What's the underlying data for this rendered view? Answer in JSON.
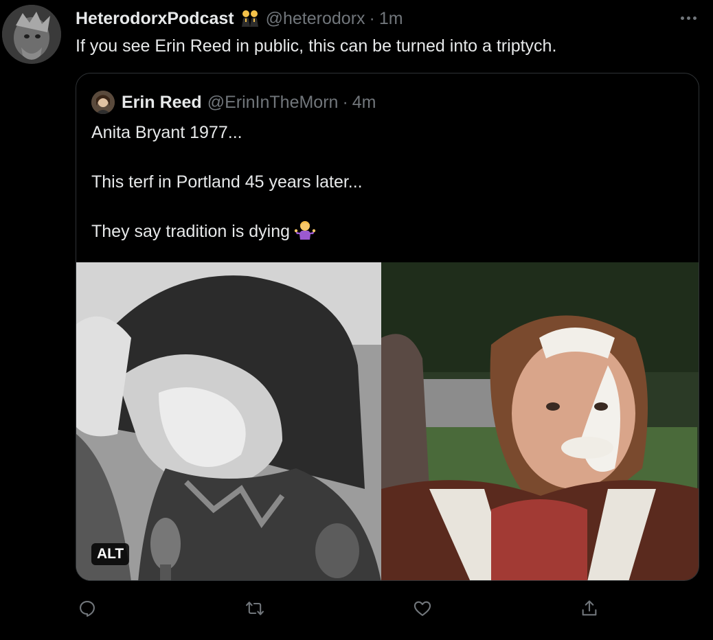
{
  "tweet": {
    "author": {
      "display_name": "HeterodorxPodcast",
      "handle": "@heterodorx",
      "time": "1m",
      "badge_emoji": "two-men-emoji"
    },
    "separator": "·",
    "text": "If you see Erin Reed in public, this can be turned into a triptych."
  },
  "quote": {
    "author": {
      "display_name": "Erin Reed",
      "handle": "@ErinInTheMorn",
      "time": "4m"
    },
    "lines": [
      "Anita Bryant 1977...",
      "This terf in Portland 45 years later...",
      "They say tradition is dying"
    ],
    "trailing_emoji": "person-shrugging-emoji",
    "media": {
      "alt_label": "ALT"
    }
  },
  "actions": {
    "icons": [
      "reply-icon",
      "retweet-icon",
      "like-icon",
      "share-icon"
    ]
  },
  "colors": {
    "background": "#000000",
    "text": "#e7e9ea",
    "muted": "#71767b",
    "border": "#2f3336"
  }
}
